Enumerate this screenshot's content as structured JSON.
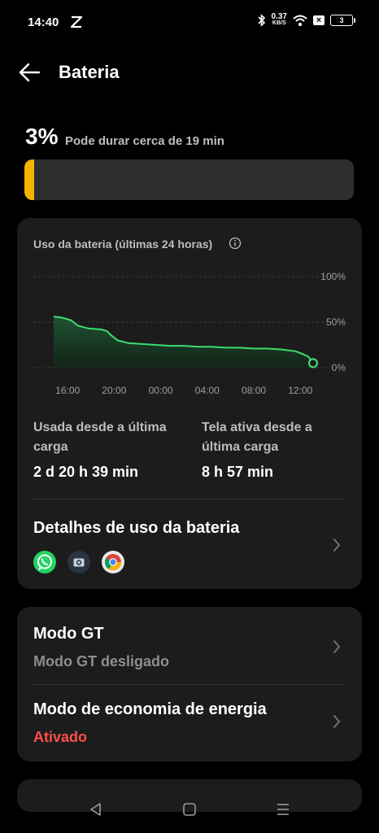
{
  "status_bar": {
    "time": "14:40",
    "net_speed_value": "0.37",
    "net_speed_unit": "KB/S",
    "battery_level": "3",
    "icons": [
      "app-logo-icon",
      "bluetooth-icon",
      "wifi-icon",
      "sim-x-icon",
      "battery-icon"
    ]
  },
  "header": {
    "title": "Bateria",
    "back_icon": "arrow-left-icon"
  },
  "battery": {
    "percent_text": "3%",
    "estimate_text": "Pode durar cerca de 19 min",
    "level_fraction": 0.03,
    "bar_color": "#f5b300"
  },
  "usage_card": {
    "title": "Uso da bateria (últimas 24 horas)",
    "stat1_label": "Usada desde a última carga",
    "stat1_value": "2 d 20 h 39 min",
    "stat2_label": "Tela ativa desde a última carga",
    "stat2_value": "8 h 57 min",
    "details_title": "Detalhes de uso da bateria",
    "apps": [
      "whatsapp-icon",
      "camera-icon",
      "chrome-icon"
    ]
  },
  "chart_data": {
    "type": "line",
    "title": "",
    "xlabel": "",
    "ylabel": "",
    "x_ticks": [
      "16:00",
      "20:00",
      "00:00",
      "04:00",
      "08:00",
      "12:00"
    ],
    "y_ticks": [
      "100%",
      "50%",
      "0%"
    ],
    "ylim": [
      0,
      100
    ],
    "line_color": "#3ddc6e",
    "series": [
      {
        "x": [
          14.8,
          15.5,
          16.3,
          16.9,
          17.8,
          18.9,
          19.4,
          19.7,
          20.3,
          21.2,
          22.4,
          23.6,
          24.8,
          26.0,
          27.2,
          28.4,
          29.6,
          30.8,
          32.0,
          33.2,
          34.4,
          35.6,
          36.2,
          36.7,
          37.1
        ],
        "y": [
          56,
          55,
          52,
          46,
          43,
          42,
          40,
          36,
          30,
          27,
          26,
          25,
          24,
          24,
          23,
          23,
          22,
          22,
          21,
          21,
          20,
          18,
          15,
          12,
          5
        ]
      }
    ]
  },
  "settings_card": {
    "gt_title": "Modo GT",
    "gt_status": "Modo GT desligado",
    "saver_title": "Modo de economia de energia",
    "saver_status": "Ativado",
    "saver_status_color": "#ff4d4d",
    "status_gray": "#8e8e8e"
  },
  "nav_bar": {
    "icons": [
      "back-triangle-icon",
      "home-square-icon",
      "recents-menu-icon"
    ]
  }
}
